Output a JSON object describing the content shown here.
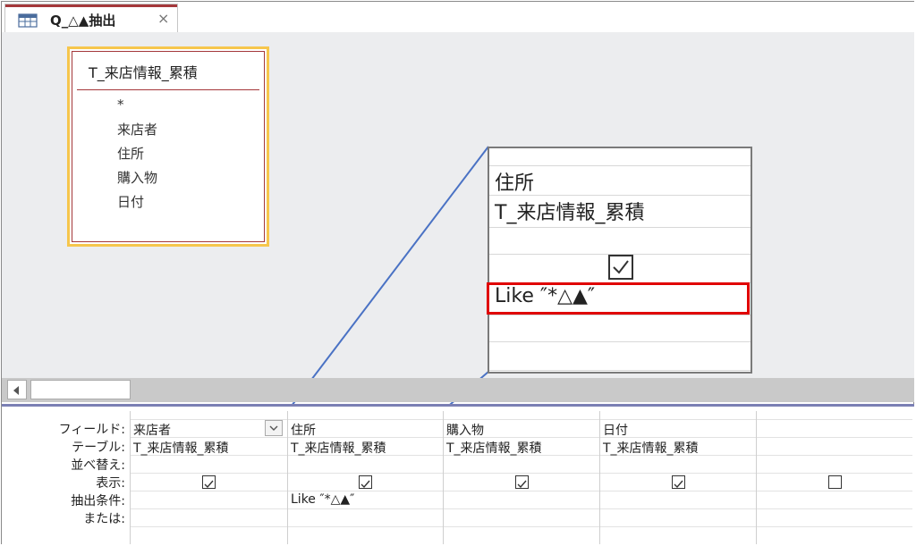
{
  "tab": {
    "title": "Q_△▲抽出",
    "close": "×"
  },
  "design": {
    "table": {
      "title": "T_来店情報_累積",
      "fields": [
        "*",
        "来店者",
        "住所",
        "購入物",
        "日付"
      ]
    }
  },
  "zoom": {
    "field": "住所",
    "table": "T_来店情報_累積",
    "criteria": "Like ″*△▲″"
  },
  "grid": {
    "row_labels": [
      "フィールド:",
      "テーブル:",
      "並べ替え:",
      "表示:",
      "抽出条件:",
      "または:"
    ],
    "columns": [
      {
        "field": "来店者",
        "table": "T_来店情報_累積",
        "show": true,
        "criteria": ""
      },
      {
        "field": "住所",
        "table": "T_来店情報_累積",
        "show": true,
        "criteria": "Like ″*△▲″"
      },
      {
        "field": "購入物",
        "table": "T_来店情報_累積",
        "show": true,
        "criteria": ""
      },
      {
        "field": "日付",
        "table": "T_来店情報_累積",
        "show": true,
        "criteria": ""
      },
      {
        "field": "",
        "table": "",
        "show": false,
        "criteria": ""
      }
    ]
  },
  "icons": {
    "query": "query-icon",
    "dropdown": "chevron-down-icon",
    "check": "check-icon"
  },
  "colors": {
    "accent": "#a4373a",
    "highlight": "#e00000",
    "selection": "#f6c64c",
    "connector": "#4a72c4"
  }
}
